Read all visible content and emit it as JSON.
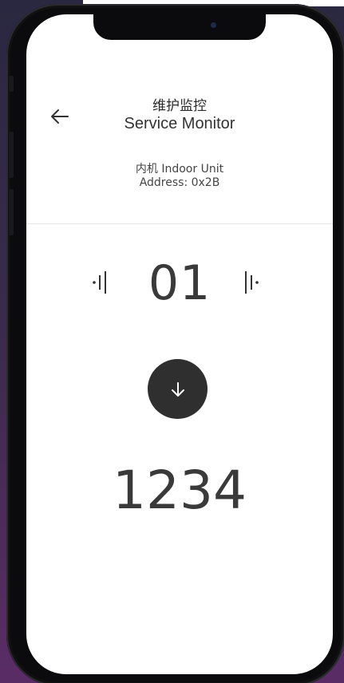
{
  "header": {
    "title_cn": "维护监控",
    "title_en": "Service Monitor",
    "device_label": "内机 Indoor Unit",
    "device_address": "Address: 0x2B"
  },
  "selector": {
    "value": "01",
    "prev_icon": "skip-previous-icon",
    "next_icon": "skip-next-icon"
  },
  "action": {
    "icon": "arrow-down-icon"
  },
  "result": {
    "value": "1234"
  },
  "colors": {
    "accent_button": "#2f2f2f",
    "text_primary": "#333333",
    "screen_background": "#ffffff"
  }
}
